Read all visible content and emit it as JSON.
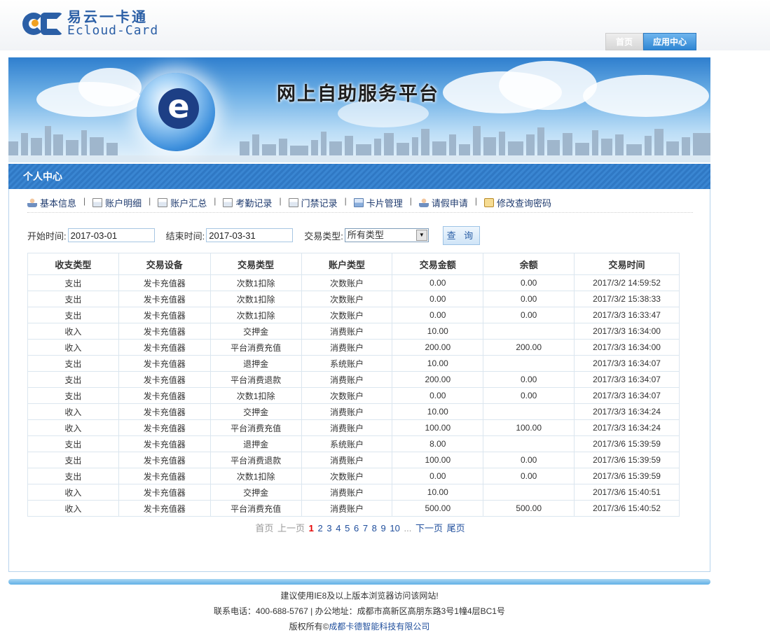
{
  "logo": {
    "cn": "易云一卡通",
    "en": "Ecloud-Card"
  },
  "top_nav": {
    "home": "首页",
    "app_center": "应用中心"
  },
  "banner": {
    "title": "网上自助服务平台"
  },
  "section": {
    "title": "个人中心"
  },
  "menu": [
    {
      "label": "基本信息",
      "icon": "user-icon"
    },
    {
      "label": "账户明细",
      "icon": "document-icon"
    },
    {
      "label": "账户汇总",
      "icon": "document-icon"
    },
    {
      "label": "考勤记录",
      "icon": "document-icon"
    },
    {
      "label": "门禁记录",
      "icon": "document-icon"
    },
    {
      "label": "卡片管理",
      "icon": "card-icon"
    },
    {
      "label": "请假申请",
      "icon": "user-icon"
    },
    {
      "label": "修改查询密码",
      "icon": "key-icon"
    }
  ],
  "filter": {
    "start_label": "开始时间:",
    "start_value": "2017-03-01",
    "end_label": "结束时间:",
    "end_value": "2017-03-31",
    "type_label": "交易类型:",
    "type_value": "所有类型",
    "query_button": "查 询"
  },
  "table": {
    "headers": [
      "收支类型",
      "交易设备",
      "交易类型",
      "账户类型",
      "交易金额",
      "余额",
      "交易时间"
    ],
    "rows": [
      [
        "支出",
        "发卡充值器",
        "次数1扣除",
        "次数账户",
        "0.00",
        "0.00",
        "2017/3/2 14:59:52"
      ],
      [
        "支出",
        "发卡充值器",
        "次数1扣除",
        "次数账户",
        "0.00",
        "0.00",
        "2017/3/2 15:38:33"
      ],
      [
        "支出",
        "发卡充值器",
        "次数1扣除",
        "次数账户",
        "0.00",
        "0.00",
        "2017/3/3 16:33:47"
      ],
      [
        "收入",
        "发卡充值器",
        "交押金",
        "消费账户",
        "10.00",
        "",
        "2017/3/3 16:34:00"
      ],
      [
        "收入",
        "发卡充值器",
        "平台消费充值",
        "消费账户",
        "200.00",
        "200.00",
        "2017/3/3 16:34:00"
      ],
      [
        "支出",
        "发卡充值器",
        "退押金",
        "系统账户",
        "10.00",
        "",
        "2017/3/3 16:34:07"
      ],
      [
        "支出",
        "发卡充值器",
        "平台消费退款",
        "消费账户",
        "200.00",
        "0.00",
        "2017/3/3 16:34:07"
      ],
      [
        "支出",
        "发卡充值器",
        "次数1扣除",
        "次数账户",
        "0.00",
        "0.00",
        "2017/3/3 16:34:07"
      ],
      [
        "收入",
        "发卡充值器",
        "交押金",
        "消费账户",
        "10.00",
        "",
        "2017/3/3 16:34:24"
      ],
      [
        "收入",
        "发卡充值器",
        "平台消费充值",
        "消费账户",
        "100.00",
        "100.00",
        "2017/3/3 16:34:24"
      ],
      [
        "支出",
        "发卡充值器",
        "退押金",
        "系统账户",
        "8.00",
        "",
        "2017/3/6 15:39:59"
      ],
      [
        "支出",
        "发卡充值器",
        "平台消费退款",
        "消费账户",
        "100.00",
        "0.00",
        "2017/3/6 15:39:59"
      ],
      [
        "支出",
        "发卡充值器",
        "次数1扣除",
        "次数账户",
        "0.00",
        "0.00",
        "2017/3/6 15:39:59"
      ],
      [
        "收入",
        "发卡充值器",
        "交押金",
        "消费账户",
        "10.00",
        "",
        "2017/3/6 15:40:51"
      ],
      [
        "收入",
        "发卡充值器",
        "平台消费充值",
        "消费账户",
        "500.00",
        "500.00",
        "2017/3/6 15:40:52"
      ]
    ]
  },
  "pager": {
    "first": "首页",
    "prev": "上一页",
    "current": "1",
    "pages": [
      "2",
      "3",
      "4",
      "5",
      "6",
      "7",
      "8",
      "9",
      "10"
    ],
    "ellipsis": "...",
    "next": "下一页",
    "last": "尾页"
  },
  "footer": {
    "line1": "建议使用IE8及以上版本浏览器访问该网站!",
    "line2": "联系电话：400-688-5767 | 办公地址：成都市高新区高朋东路3号1幢4层BC1号",
    "copyright_prefix": "版权所有©",
    "company": "成都卡德智能科技有限公司"
  },
  "colors": {
    "brand_blue": "#2b5fa6",
    "section_bar": "#3a86d2",
    "pager_current": "#e60000",
    "link": "#1f4e9c"
  }
}
